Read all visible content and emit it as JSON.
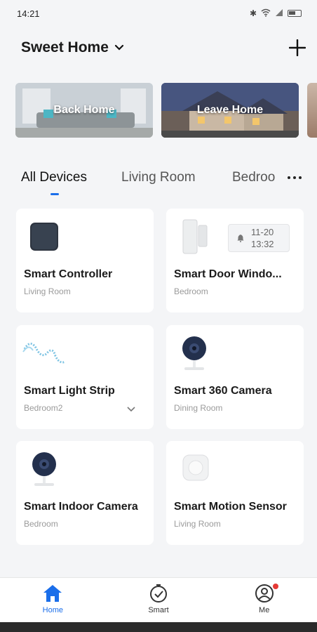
{
  "status_bar": {
    "time": "14:21"
  },
  "header": {
    "home_name": "Sweet Home"
  },
  "scenes": [
    {
      "label": "Back Home"
    },
    {
      "label": "Leave Home"
    }
  ],
  "tabs": [
    {
      "label": "All Devices",
      "active": true
    },
    {
      "label": "Living Room"
    },
    {
      "label": "Bedroo"
    }
  ],
  "devices": [
    {
      "name": "Smart Controller",
      "room": "Living Room",
      "icon": "hub-icon"
    },
    {
      "name": "Smart Door Windo...",
      "room": "Bedroom",
      "icon": "door-sensor-icon",
      "badge_date": "11-20",
      "badge_time": "13:32"
    },
    {
      "name": "Smart Light Strip",
      "room": "Bedroom2",
      "icon": "light-strip-icon"
    },
    {
      "name": "Smart 360 Camera",
      "room": "Dining Room",
      "icon": "camera-icon"
    },
    {
      "name": "Smart Indoor Camera",
      "room": "Bedroom",
      "icon": "camera-icon"
    },
    {
      "name": "Smart Motion Sensor",
      "room": "Living Room",
      "icon": "motion-sensor-icon"
    }
  ],
  "nav": [
    {
      "label": "Home",
      "icon": "home-icon",
      "active": true
    },
    {
      "label": "Smart",
      "icon": "smart-timer-icon"
    },
    {
      "label": "Me",
      "icon": "user-icon"
    }
  ],
  "colors": {
    "accent": "#1a6eea",
    "background": "#f4f5f7",
    "badge": "#e53935"
  }
}
